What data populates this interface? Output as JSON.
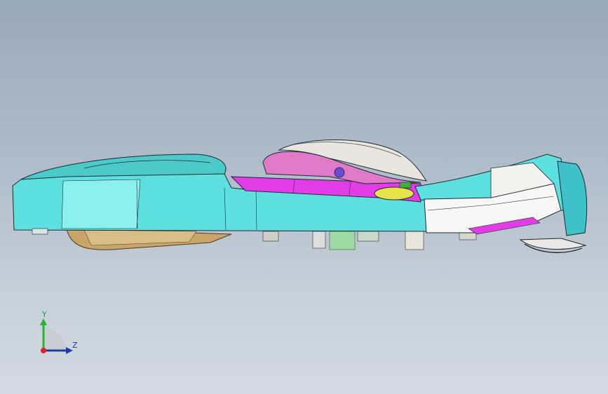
{
  "viewport": {
    "background_top": "#9aa8bb",
    "background_bottom": "#d3dae1"
  },
  "model": {
    "colors": {
      "cyan_body": "#5ee0e0",
      "cyan_light": "#8cf0ee",
      "magenta": "#e23ce6",
      "pink": "#e07ac8",
      "shell": "#e8e6de",
      "tan": "#c9a56a",
      "yellow": "#e6e24a",
      "white_panel": "#f7f7f7",
      "green": "#3fae3f",
      "outline": "#1d2a33"
    }
  },
  "triad": {
    "y_label": "Y",
    "z_label": "Z",
    "y_color": "#2bb13a",
    "z_color": "#1f3ea8",
    "origin_color": "#d8242a"
  }
}
